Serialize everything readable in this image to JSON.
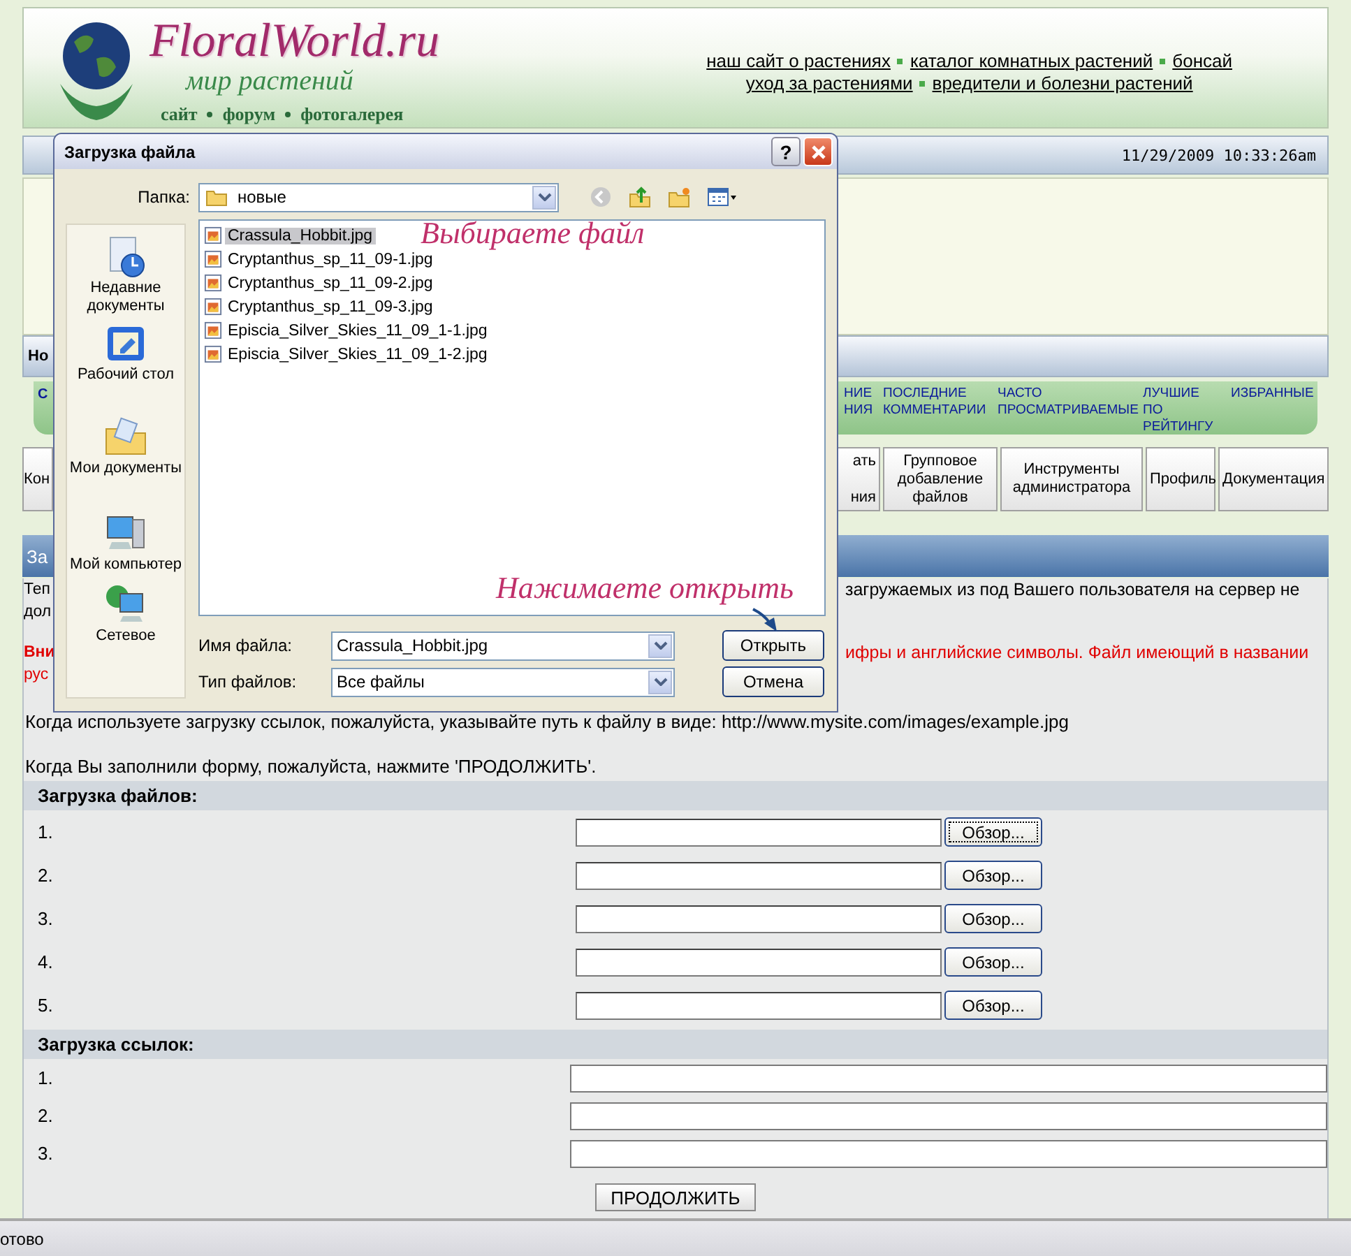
{
  "header": {
    "site_name": "FloralWorld.ru",
    "tagline": "мир растений",
    "logo_links": [
      "сайт",
      "форум",
      "фотогалерея"
    ],
    "link_rows": [
      {
        "links": [
          "наш сайт о растениях",
          "каталог комнатных растений",
          "бонсай"
        ]
      },
      {
        "links": [
          "уход за растениями",
          "вредители и болезни растений"
        ]
      }
    ]
  },
  "datetime": "11/29/2009 10:33:26am",
  "user_bar_fragment": "Но",
  "nav_left_fragment": "С",
  "nav_tabs": [
    {
      "label": "НИЕ\nНИЯ"
    },
    {
      "label": "ПОСЛЕДНИЕ\nКОММЕНТАРИИ"
    },
    {
      "label": "ЧАСТО\nПРОСМАТРИВАЕМЫЕ"
    },
    {
      "label": "ЛУЧШИЕ\nПО\nРЕЙТИНГУ"
    },
    {
      "label": "ИЗБРАННЫЕ"
    }
  ],
  "menu_left_fragment": "Кон",
  "menu_buttons": [
    {
      "label": "ать\n\nния"
    },
    {
      "label": "Групповое\nдобавление\nфайлов"
    },
    {
      "label": "Инструменты\nадминистратора"
    },
    {
      "label": "Профиль"
    },
    {
      "label": "Документация"
    }
  ],
  "section_title_fragment": "За",
  "intro": {
    "left": [
      "Теп",
      "дол"
    ],
    "right": "загружаемых из под Вашего пользователя на сервер не"
  },
  "warning": {
    "left": [
      "Вни",
      "рус"
    ],
    "right": "ифры и английские символы. Файл имеющий в названии"
  },
  "links_hint": "Когда используете загрузку ссылок, пожалуйста, указывайте путь к файлу в виде: http://www.mysite.com/images/example.jpg",
  "submit_hint": "Когда Вы заполнили форму, пожалуйста, нажмите 'ПРОДОЛЖИТЬ'.",
  "file_upload": {
    "title": "Загрузка файлов:",
    "rows": [
      {
        "number": "1.",
        "button": "Обзор...",
        "focused": true
      },
      {
        "number": "2.",
        "button": "Обзор...",
        "focused": false
      },
      {
        "number": "3.",
        "button": "Обзор...",
        "focused": false
      },
      {
        "number": "4.",
        "button": "Обзор...",
        "focused": false
      },
      {
        "number": "5.",
        "button": "Обзор...",
        "focused": false
      }
    ]
  },
  "link_upload": {
    "title": "Загрузка ссылок:",
    "rows": [
      {
        "number": "1."
      },
      {
        "number": "2."
      },
      {
        "number": "3."
      }
    ]
  },
  "submit_button": "ПРОДОЛЖИТЬ",
  "status_bar": "отово",
  "dialog": {
    "title": "Загрузка файла",
    "help_button": "?",
    "folder_label": "Папка:",
    "folder": "новые",
    "places": [
      {
        "label": "Недавние документы",
        "kind": "recent"
      },
      {
        "label": "Рабочий стол",
        "kind": "desktop"
      },
      {
        "label": "Мои документы",
        "kind": "documents"
      },
      {
        "label": "Мой компьютер",
        "kind": "computer"
      },
      {
        "label": "Сетевое",
        "kind": "network"
      }
    ],
    "files": [
      {
        "name": "Crassula_Hobbit.jpg",
        "selected": true
      },
      {
        "name": "Cryptanthus_sp_11_09-1.jpg",
        "selected": false
      },
      {
        "name": "Cryptanthus_sp_11_09-2.jpg",
        "selected": false
      },
      {
        "name": "Cryptanthus_sp_11_09-3.jpg",
        "selected": false
      },
      {
        "name": "Episcia_Silver_Skies_11_09_1-1.jpg",
        "selected": false
      },
      {
        "name": "Episcia_Silver_Skies_11_09_1-2.jpg",
        "selected": false
      }
    ],
    "file_name_label": "Имя файла:",
    "file_name": "Crassula_Hobbit.jpg",
    "file_type_label": "Тип файлов:",
    "file_type": "Все файлы",
    "open_button": "Открыть",
    "cancel_button": "Отмена",
    "annotations": [
      {
        "text": "Выбираете файл",
        "kind": "label"
      },
      {
        "text": "Нажимаете открыть",
        "kind": "arrow"
      }
    ]
  }
}
